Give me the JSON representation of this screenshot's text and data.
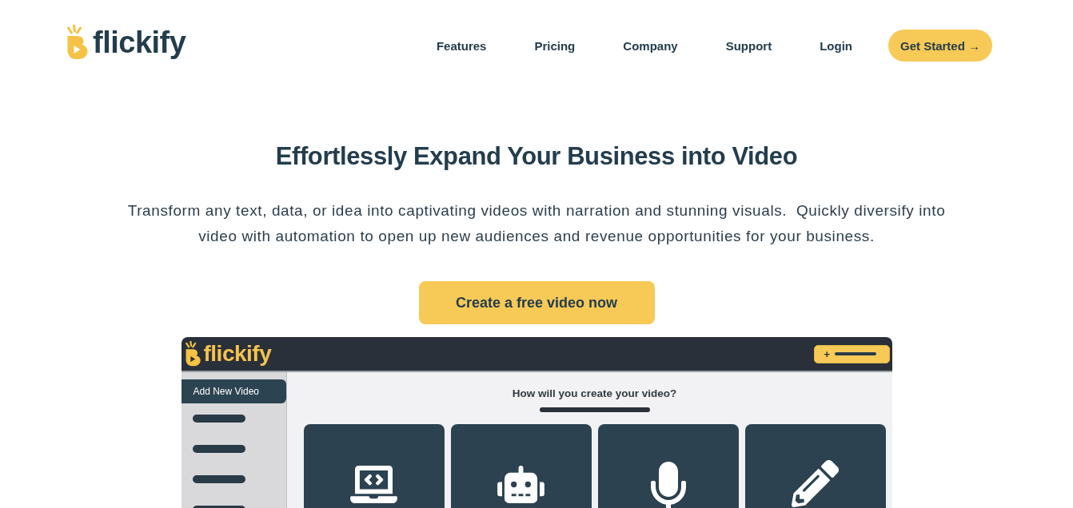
{
  "header": {
    "logo": "flickify",
    "nav": [
      {
        "label": "Features"
      },
      {
        "label": "Pricing"
      },
      {
        "label": "Company"
      },
      {
        "label": "Support"
      },
      {
        "label": "Login"
      }
    ],
    "cta": "Get Started →"
  },
  "hero": {
    "title": "Effortlessly Expand Your Business into Video",
    "description": "Transform any text, data, or idea into captivating videos with narration and stunning visuals.  Quickly diversify into video with automation to open up new audiences and revenue opportunities for your business.",
    "button": "Create a free video now"
  },
  "app_preview": {
    "logo": "flickify",
    "add_button": "+",
    "sidebar": {
      "items": [
        {
          "kind": "label",
          "label": "Add New Video",
          "selected": true
        },
        {
          "kind": "placeholder",
          "selected": false
        },
        {
          "kind": "placeholder",
          "selected": false
        },
        {
          "kind": "placeholder",
          "selected": false
        },
        {
          "kind": "placeholder",
          "selected": false
        }
      ]
    },
    "prompt": "How will you create your video?"
  }
}
